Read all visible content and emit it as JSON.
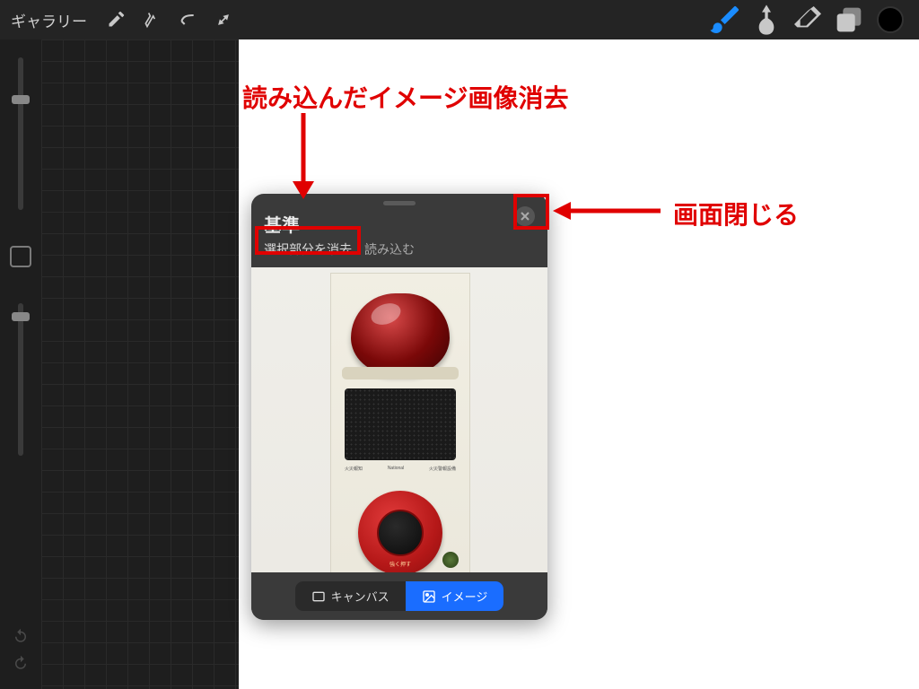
{
  "topbar": {
    "gallery": "ギャラリー"
  },
  "ref_panel": {
    "title": "基準",
    "clear_selection": "選択部分を消去",
    "load": "読み込む",
    "seg_canvas": "キャンバス",
    "seg_image": "イメージ"
  },
  "annotations": {
    "clear_image": "読み込んだイメージ画像消去",
    "close_panel": "画面閉じる"
  },
  "alarm": {
    "brand": "National",
    "push": "強く押す"
  }
}
